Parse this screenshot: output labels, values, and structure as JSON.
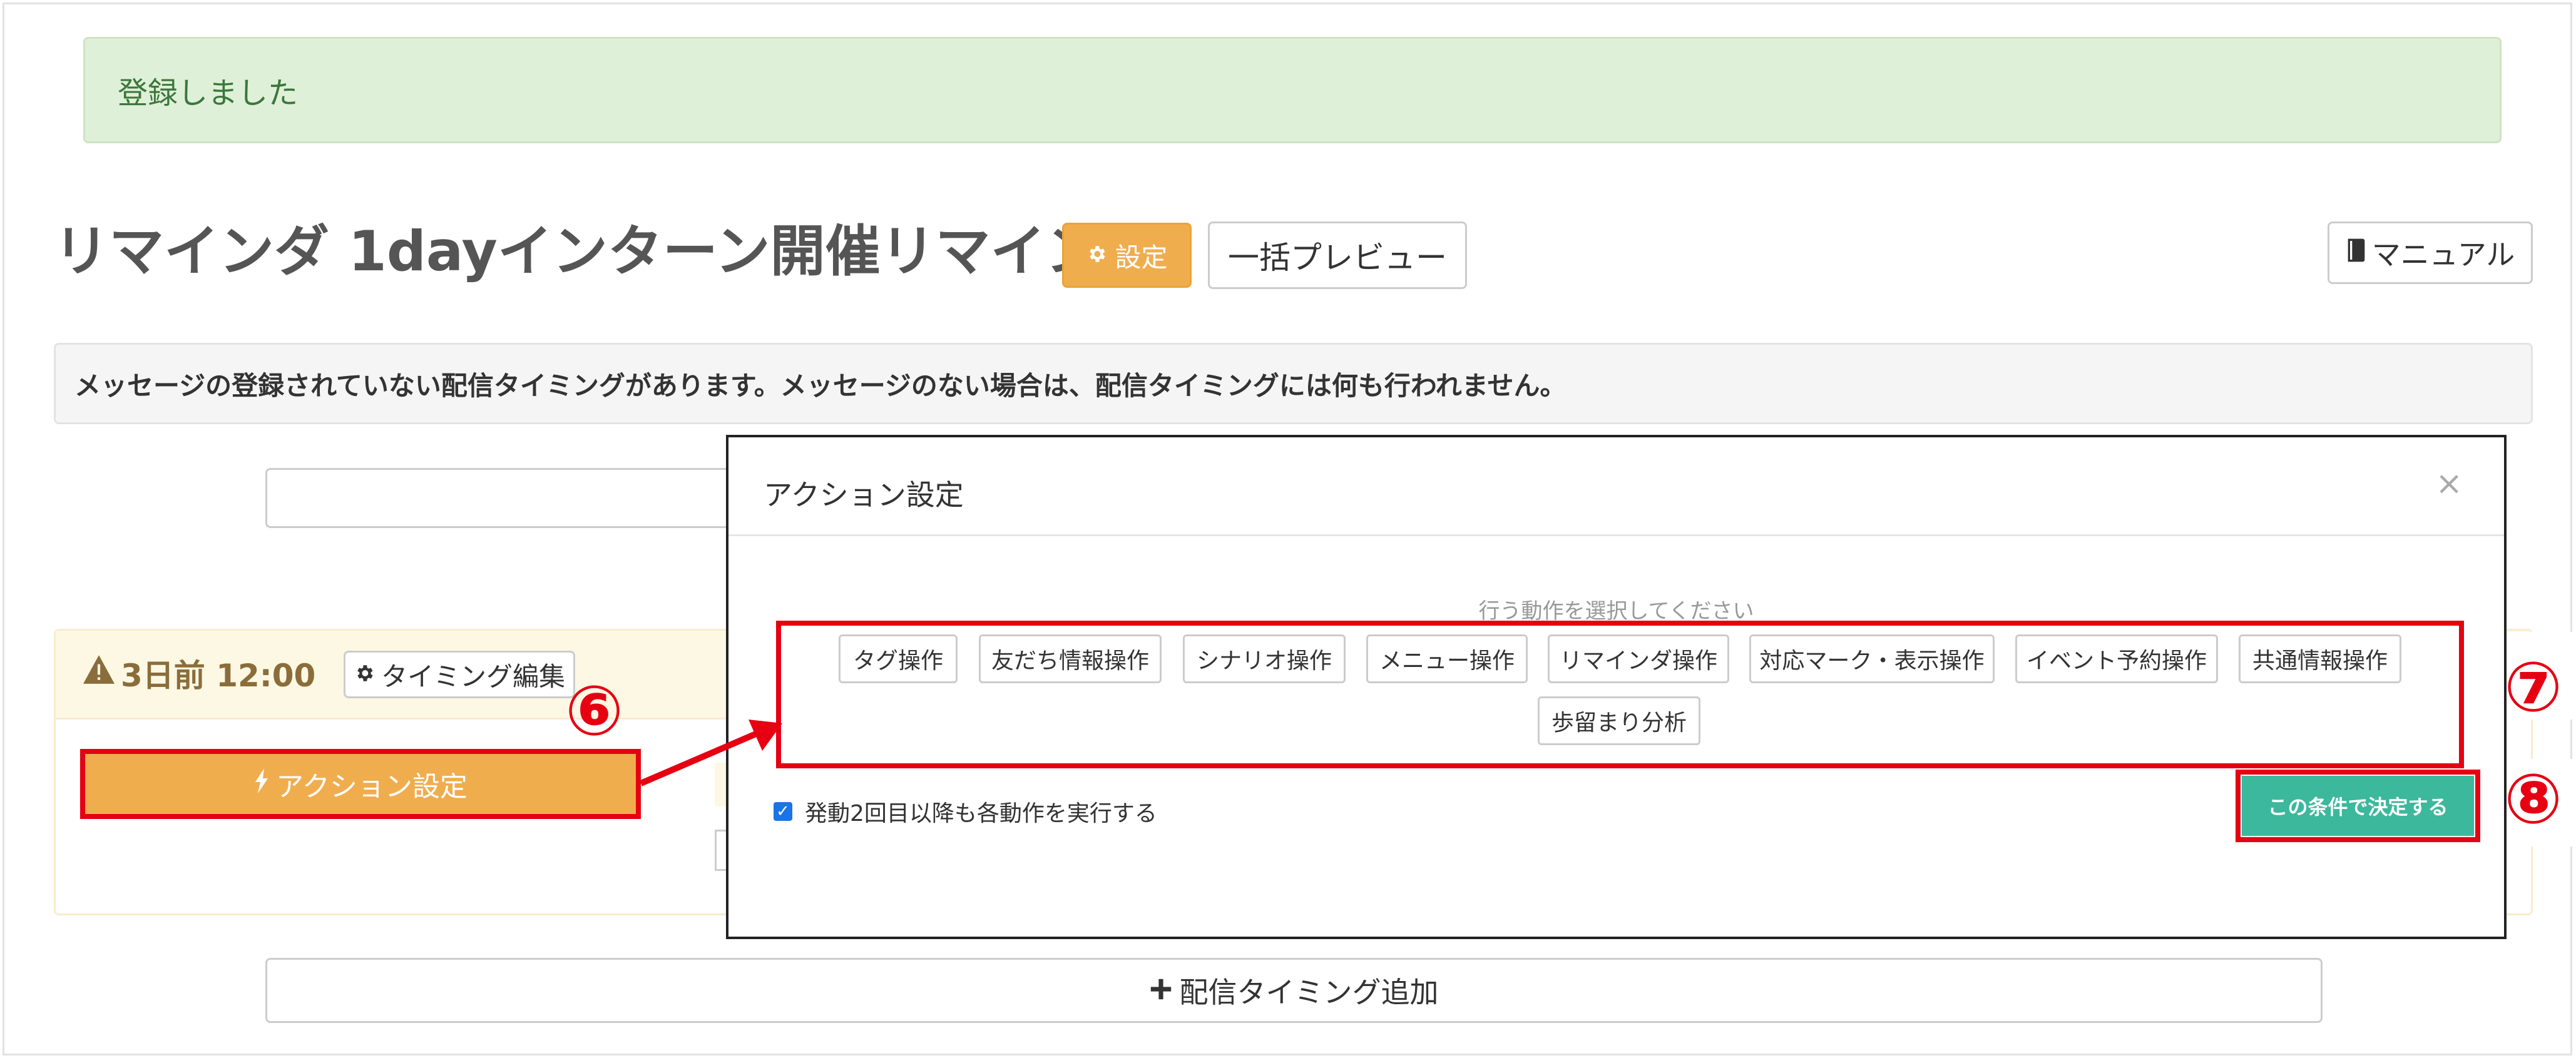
{
  "alert": {
    "message": "登録しました"
  },
  "header": {
    "title": "リマインダ 1dayインターン開催リマインド",
    "settings_label": "設定",
    "preview_label": "一括プレビュー",
    "manual_label": "マニュアル"
  },
  "warning": {
    "text": "メッセージの登録されていない配信タイミングがあります。メッセージのない場合は、配信タイミングには何も行われません。"
  },
  "timing": {
    "label": "3日前 12:00",
    "edit_label": "タイミング編集",
    "action_label": "アクション設定"
  },
  "add_timing": {
    "label": "配信タイミング追加"
  },
  "modal": {
    "title": "アクション設定",
    "close": "×",
    "hint": "行う動作を選択してください",
    "operations": [
      "タグ操作",
      "友だち情報操作",
      "シナリオ操作",
      "メニュー操作",
      "リマインダ操作",
      "対応マーク・表示操作",
      "イベント予約操作",
      "共通情報操作",
      "歩留まり分析"
    ],
    "checkbox_label": "発動2回目以降も各動作を実行する",
    "checkbox_checked": true,
    "confirm_label": "この条件で決定する"
  },
  "annotations": {
    "step6": "⑥",
    "step7": "⑦",
    "step8": "⑧"
  },
  "colors": {
    "highlight": "#e60012",
    "warning_button": "#f0ad4e",
    "confirm_button": "#3cb89c",
    "alert_bg": "#dff0d8"
  },
  "icons": {
    "settings": "gear-icon",
    "manual": "book-icon",
    "timing_warning": "warning-icon",
    "timing_edit": "gear-icon",
    "action": "bolt-icon",
    "add": "plus-icon",
    "checkbox": "check-icon"
  }
}
